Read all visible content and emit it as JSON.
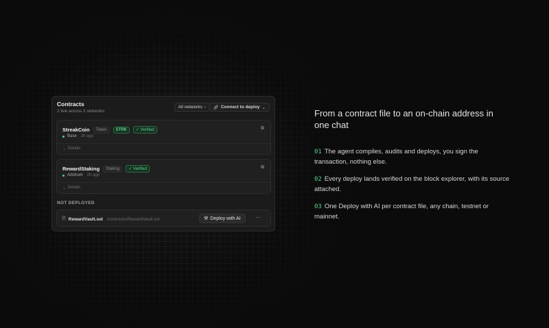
{
  "panel": {
    "title": "Contracts",
    "subtitle": "2 live across 2 networks",
    "networks_button": "All networks",
    "connect_button": "Connect to deploy"
  },
  "contracts": [
    {
      "name": "StreakCoin",
      "type": "Token",
      "symbol": "STRK",
      "status": "Verified",
      "network": "Base",
      "time": "2h ago",
      "details": "Details"
    },
    {
      "name": "RewardStaking",
      "type": "Staking",
      "status": "Verified",
      "network": "Arbitrum",
      "time": "2h ago",
      "details": "Details"
    }
  ],
  "not_deployed": {
    "label": "NOT DEPLOYED",
    "file_name": "RewardVault.sol",
    "file_path": "/contracts/RewardVault.sol",
    "deploy_button": "Deploy with AI",
    "more": "···"
  },
  "headline": "From a contract file to an on-chain address in one chat",
  "features": [
    {
      "num": "01",
      "text": "The agent compiles, audits and deploys, you sign the transaction, nothing else."
    },
    {
      "num": "02",
      "text": "Every deploy lands verified on the block explorer, with its source attached."
    },
    {
      "num": "03",
      "text": "One Deploy with AI per contract file, any chain, testnet or mainnet."
    }
  ],
  "colors": {
    "accent": "#5ad18a",
    "background": "#0b0b0b",
    "panel": "#1b1b1b"
  },
  "icons": {
    "chevron": "chevron-right-icon",
    "link": "link-icon",
    "external": "external-link-icon",
    "file": "file-icon",
    "hammer": "hammer-icon",
    "check": "check-icon"
  }
}
